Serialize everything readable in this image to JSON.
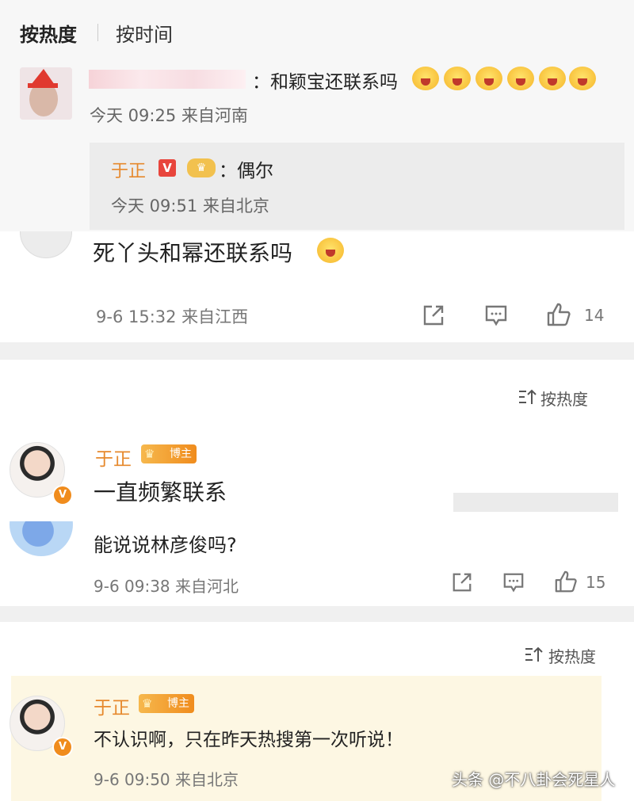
{
  "header": {
    "tab_hot": "按热度",
    "tab_time": "按时间"
  },
  "comment1": {
    "text": "：和颖宝还联系吗",
    "emoji_count": 6,
    "meta": "今天 09:25 来自河南"
  },
  "reply1": {
    "author": "于正",
    "v_badge": "V",
    "text": "：偶尔",
    "meta": "今天 09:51 来自北京"
  },
  "comment2": {
    "text": "死丫头和幂还联系吗",
    "meta": "9-6 15:32 来自江西",
    "likes": "14"
  },
  "sort_label_1": "按热度",
  "comment3": {
    "author": "于正",
    "badge": "博主",
    "text": "一直频繁联系"
  },
  "comment4": {
    "text": "能说说林彦俊吗?",
    "meta": "9-6 09:38 来自河北",
    "likes": "15"
  },
  "sort_label_2": "按热度",
  "comment5": {
    "author": "于正",
    "badge": "博主",
    "text": "不认识啊，只在昨天热搜第一次听说！",
    "meta": "9-6 09:50 来自北京"
  },
  "avatar_badge": "V",
  "watermark": "头条 @不八卦会死星人",
  "colors": {
    "author_orange": "#e6892d",
    "highlight_bg": "#fdf7e3",
    "reply_bg": "#ececec"
  },
  "icons": [
    "share-icon",
    "comment-icon",
    "like-icon",
    "sort-icon"
  ]
}
